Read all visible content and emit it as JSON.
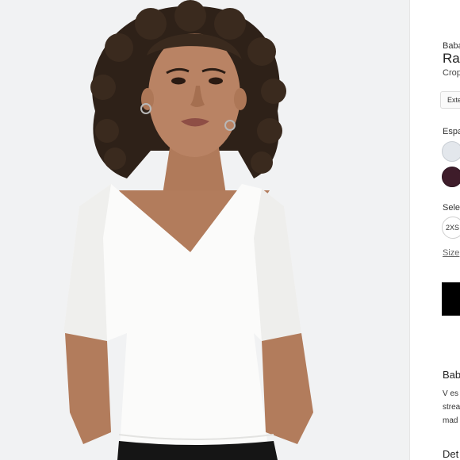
{
  "product": {
    "brand": "Baba",
    "name": "Ra",
    "subtitle": "Crop",
    "tag": "Exte"
  },
  "colors": {
    "label": "Espa",
    "swatches": [
      {
        "name": "light-blue-gray",
        "hex": "#e3e7ec"
      },
      {
        "name": "dark-plum",
        "hex": "#3e1c2a"
      }
    ]
  },
  "sizes": {
    "label": "Sele",
    "options": [
      "2XS"
    ],
    "guide_link": "Size"
  },
  "buy_button": {
    "label": ""
  },
  "description": {
    "title": "Bab",
    "lines": [
      "V es",
      "strea",
      "mad"
    ]
  },
  "details": {
    "title": "Det"
  }
}
